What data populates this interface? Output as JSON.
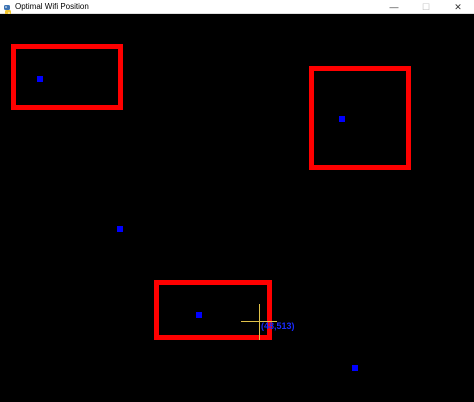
{
  "window": {
    "title": "Optimal Wifi Position",
    "controls": {
      "minimize": "—",
      "maximize": "☐",
      "close": "✕"
    }
  },
  "canvas": {
    "background": "#000000",
    "wall_color": "#ff0000",
    "device_color": "#0000ff",
    "cursor_color": "#e0c24a",
    "cursor_readout": "(48,513)"
  }
}
